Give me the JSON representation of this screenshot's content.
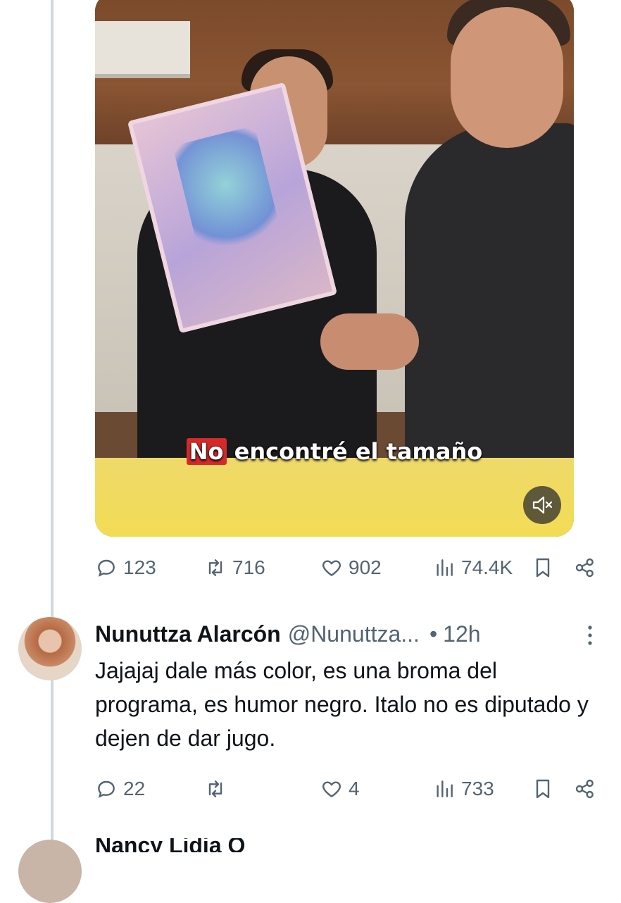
{
  "video": {
    "caption_highlight": "No",
    "caption_rest": " encontré el tamaño",
    "mute_icon": "mute-icon"
  },
  "tweet_actions": {
    "replies": "123",
    "reposts": "716",
    "likes": "902",
    "views": "74.4K"
  },
  "reply": {
    "name": "Nunuttza Alarcón",
    "handle": "@Nunuttza...",
    "dot": "•",
    "time": "12h",
    "text": "Jajajaj dale más color, es una broma del programa, es humor negro. Italo no es diputado y dejen de dar jugo.",
    "actions": {
      "replies": "22",
      "reposts": "",
      "likes": "4",
      "views": "733"
    }
  },
  "next_reply": {
    "name": "Nancy Lidia Q"
  },
  "colors": {
    "muted": "#536471",
    "text": "#0f1419",
    "thread_line": "#cfd9de"
  }
}
